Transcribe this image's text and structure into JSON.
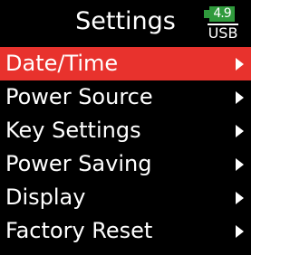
{
  "header": {
    "title": "Settings",
    "battery_level": "4.9",
    "power_label": "USB"
  },
  "menu": {
    "items": [
      {
        "label": "Date/Time",
        "selected": true
      },
      {
        "label": "Power Source",
        "selected": false
      },
      {
        "label": "Key Settings",
        "selected": false
      },
      {
        "label": "Power Saving",
        "selected": false
      },
      {
        "label": "Display",
        "selected": false
      },
      {
        "label": "Factory Reset",
        "selected": false
      }
    ]
  },
  "colors": {
    "background": "#000000",
    "highlight": "#e8322d",
    "battery": "#2f9a3c",
    "text": "#ffffff"
  },
  "icons": {
    "submenu": "chevron-right-icon",
    "battery": "battery-icon"
  }
}
